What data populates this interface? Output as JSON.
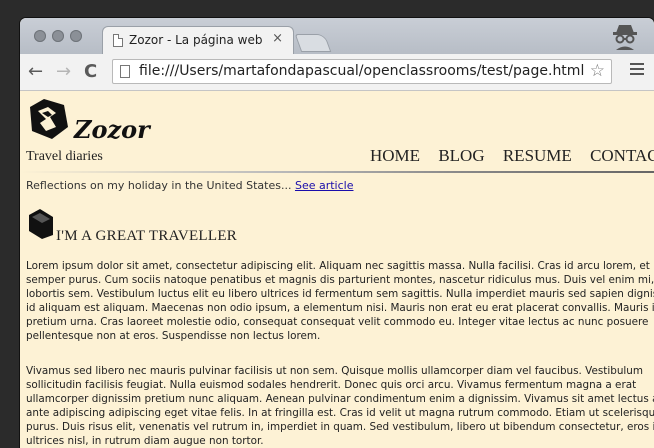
{
  "browser": {
    "tab_title": "Zozor - La página web",
    "tab_close": "×",
    "url": "file:///Users/martafondapascual/openclassrooms/test/page.html",
    "back_icon": "←",
    "forward_icon": "→",
    "reload_icon": "C",
    "star_icon": "☆"
  },
  "site": {
    "logo_text": "Zozor",
    "tagline": "Travel diaries",
    "nav": [
      "HOME",
      "BLOG",
      "RESUME",
      "CONTACT"
    ],
    "reflection_text": "Reflections on my holiday in the United States... ",
    "reflection_link": "See article "
  },
  "article": {
    "title": "I'M A GREAT TRAVELLER",
    "paragraphs": [
      "Lorem ipsum dolor sit amet, consectetur adipiscing elit. Aliquam nec sagittis massa. Nulla facilisi. Cras id arcu lorem, et semper purus. Cum sociis natoque penatibus et magnis dis parturient montes, nascetur ridiculus mus. Duis vel enim mi, in lobortis sem. Vestibulum luctus elit eu libero ultrices id fermentum sem sagittis. Nulla imperdiet mauris sed sapien dignissim id aliquam est aliquam. Maecenas non odio ipsum, a elementum nisi. Mauris non erat eu erat placerat convallis. Mauris in pretium urna. Cras laoreet molestie odio, consequat consequat velit commodo eu. Integer vitae lectus ac nunc posuere pellentesque non at eros. Suspendisse non lectus lorem.",
      "Vivamus sed libero nec mauris pulvinar facilisis ut non sem. Quisque mollis ullamcorper diam vel faucibus. Vestibulum sollicitudin facilisis feugiat. Nulla euismod sodales hendrerit. Donec quis orci arcu. Vivamus fermentum magna a erat ullamcorper dignissim pretium nunc aliquam. Aenean pulvinar condimentum enim a dignissim. Vivamus sit amet lectus at ante adipiscing adipiscing eget vitae felis. In at fringilla est. Cras id velit ut magna rutrum commodo. Etiam ut scelerisque purus. Duis risus elit, venenatis vel rutrum in, imperdiet in quam. Sed vestibulum, libero ut bibendum consectetur, eros ipsum ultrices nisl, in rutrum diam augue non tortor."
    ]
  }
}
